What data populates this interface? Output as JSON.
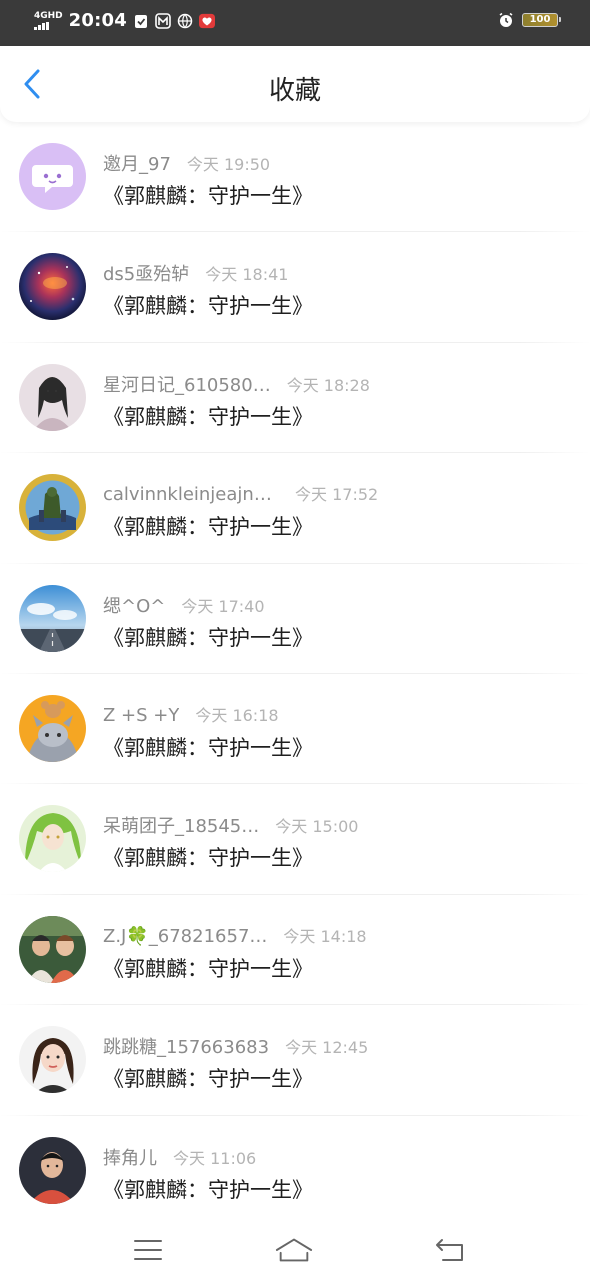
{
  "status_bar": {
    "network": "4GHD",
    "time": "20:04",
    "battery": "100"
  },
  "header": {
    "title": "收藏"
  },
  "items": [
    {
      "username": "邀月_97",
      "timestamp": "今天 19:50",
      "title": "《郭麒麟：守护一生》"
    },
    {
      "username": "ds5亟殆轳",
      "timestamp": "今天 18:41",
      "title": "《郭麒麟：守护一生》"
    },
    {
      "username": "星河日记_610580…",
      "timestamp": "今天 18:28",
      "title": "《郭麒麟：守护一生》"
    },
    {
      "username": "calvinnkleinjeajnpls",
      "timestamp": "今天 17:52",
      "title": "《郭麒麟：守护一生》"
    },
    {
      "username": "缌^O^",
      "timestamp": "今天 17:40",
      "title": "《郭麒麟：守护一生》"
    },
    {
      "username": "Z +S +Y",
      "timestamp": "今天 16:18",
      "title": "《郭麒麟：守护一生》"
    },
    {
      "username": "呆萌团子_18545…",
      "timestamp": "今天 15:00",
      "title": "《郭麒麟：守护一生》"
    },
    {
      "username": "Z.J🍀_67821657…",
      "timestamp": "今天 14:18",
      "title": "《郭麒麟：守护一生》"
    },
    {
      "username": "跳跳糖_157663683",
      "timestamp": "今天 12:45",
      "title": "《郭麒麟：守护一生》"
    },
    {
      "username": "捧角儿",
      "timestamp": "今天 11:06",
      "title": "《郭麒麟：守护一生》"
    }
  ],
  "colors": {
    "accent": "#2f8ef0",
    "status_bar_bg": "#3a3a3a"
  }
}
